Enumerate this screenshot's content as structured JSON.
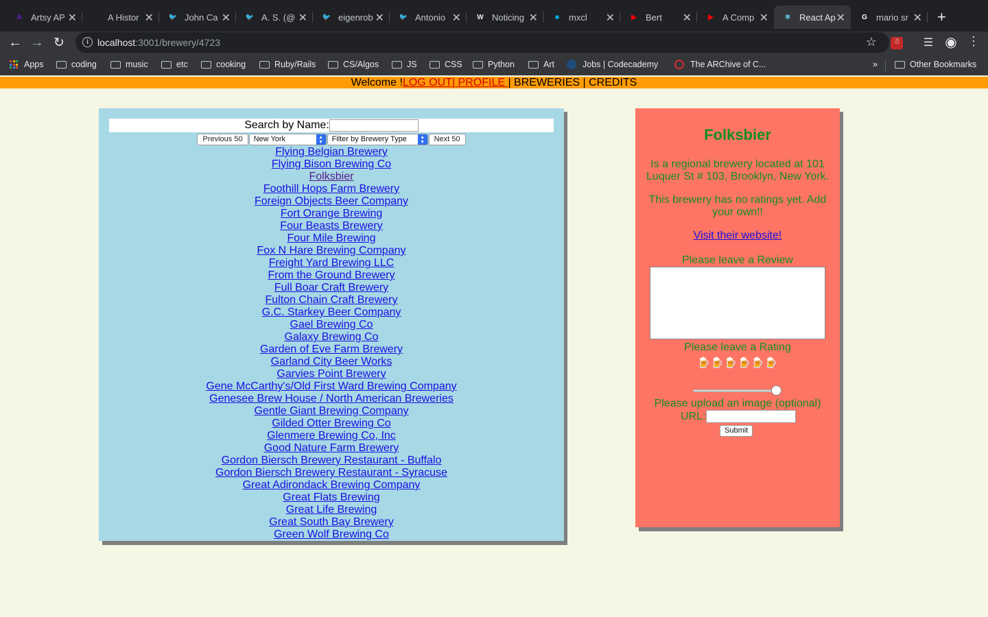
{
  "browser": {
    "tabs": [
      {
        "title": "Artsy AP",
        "icon": "artsy-icon",
        "color": "#6a1bd1"
      },
      {
        "title": "A Histor",
        "icon": "medium-icon",
        "color": "#202124"
      },
      {
        "title": "John Ca",
        "icon": "twitter-icon",
        "color": "#1d9bf0"
      },
      {
        "title": "A. S. (@",
        "icon": "twitter-icon",
        "color": "#1d9bf0"
      },
      {
        "title": "eigenrob",
        "icon": "twitter-icon",
        "color": "#1d9bf0"
      },
      {
        "title": "Antonio",
        "icon": "twitter-icon",
        "color": "#1d9bf0"
      },
      {
        "title": "Noticing",
        "icon": "wordpress-icon",
        "color": "#e8eaed"
      },
      {
        "title": "mxcl",
        "icon": "site-icon",
        "color": "#00b4e6"
      },
      {
        "title": "Bert",
        "icon": "youtube-icon",
        "color": "#ff0000"
      },
      {
        "title": "A Comp",
        "icon": "youtube-icon",
        "color": "#ff0000"
      },
      {
        "title": "React Ap",
        "icon": "react-icon",
        "color": "#61dafb"
      },
      {
        "title": "mario sr",
        "icon": "google-icon",
        "color": "#ffffff"
      }
    ],
    "url_host": "localhost",
    "url_path": ":3001/brewery/4723",
    "bookmarks": [
      "Apps",
      "coding",
      "music",
      "etc",
      "cooking",
      "Ruby/Rails",
      "CS/Algos",
      "JS",
      "CSS",
      "Python",
      "Art",
      "Jobs | Codecademy",
      "The ARChive of C...",
      "Other Bookmarks"
    ],
    "bookmarks_overflow": "»"
  },
  "nav": {
    "welcome": "Welcome !",
    "logout": "LOG OUT",
    "sep1": "| ",
    "profile": "PROFILE ",
    "rest": "| BREWERIES | CREDITS"
  },
  "search": {
    "label": "Search by Name:",
    "value": ""
  },
  "controls": {
    "prev": "Previous 50",
    "state": "New York",
    "type_filter": "Filter by Brewery Type",
    "next": "Next 50"
  },
  "breweries": [
    "Flying Belgian Brewery",
    "Flying Bison Brewing Co",
    "Folksbier",
    "Foothill Hops Farm Brewery",
    "Foreign Objects Beer Company",
    "Fort Orange Brewing",
    "Four Beasts Brewery",
    "Four Mile Brewing",
    "Fox N Hare Brewing Company",
    "Freight Yard Brewing LLC",
    "From the Ground Brewery",
    "Full Boar Craft Brewery",
    "Fulton Chain Craft Brewery",
    "G.C. Starkey Beer Company",
    "Gael Brewing Co",
    "Galaxy Brewing Co",
    "Garden of Eve Farm Brewery",
    "Garland City Beer Works",
    "Garvies Point Brewery",
    "Gene McCarthy's/Old First Ward Brewing Company",
    "Genesee Brew House / North American Breweries",
    "Gentle Giant Brewing Company",
    "Gilded Otter Brewing Co",
    "Glenmere Brewing Co, Inc",
    "Good Nature Farm Brewery",
    "Gordon Biersch Brewery Restaurant - Buffalo",
    "Gordon Biersch Brewery Restaurant - Syracuse",
    "Great Adirondack Brewing Company",
    "Great Flats Brewing",
    "Great Life Brewing",
    "Great South Bay Brewery",
    "Green Wolf Brewing Co"
  ],
  "visited_index": 2,
  "detail": {
    "name": "Folksbier",
    "description": "Is a regional brewery located at 101 Luquer St # 103, Brooklyn, New York.",
    "rating_text": "This brewery has no ratings yet. Add your own!!",
    "website_link": "Visit their website!",
    "review_label": "Please leave a Review",
    "rating_label": "Please leave a Rating",
    "mugs": "🍺🍺🍺🍺🍺🍺",
    "rating_slider_value": 1.0,
    "upload_label": "Please upload an image (optional)",
    "url_label": "URL:",
    "submit": "Submit"
  }
}
